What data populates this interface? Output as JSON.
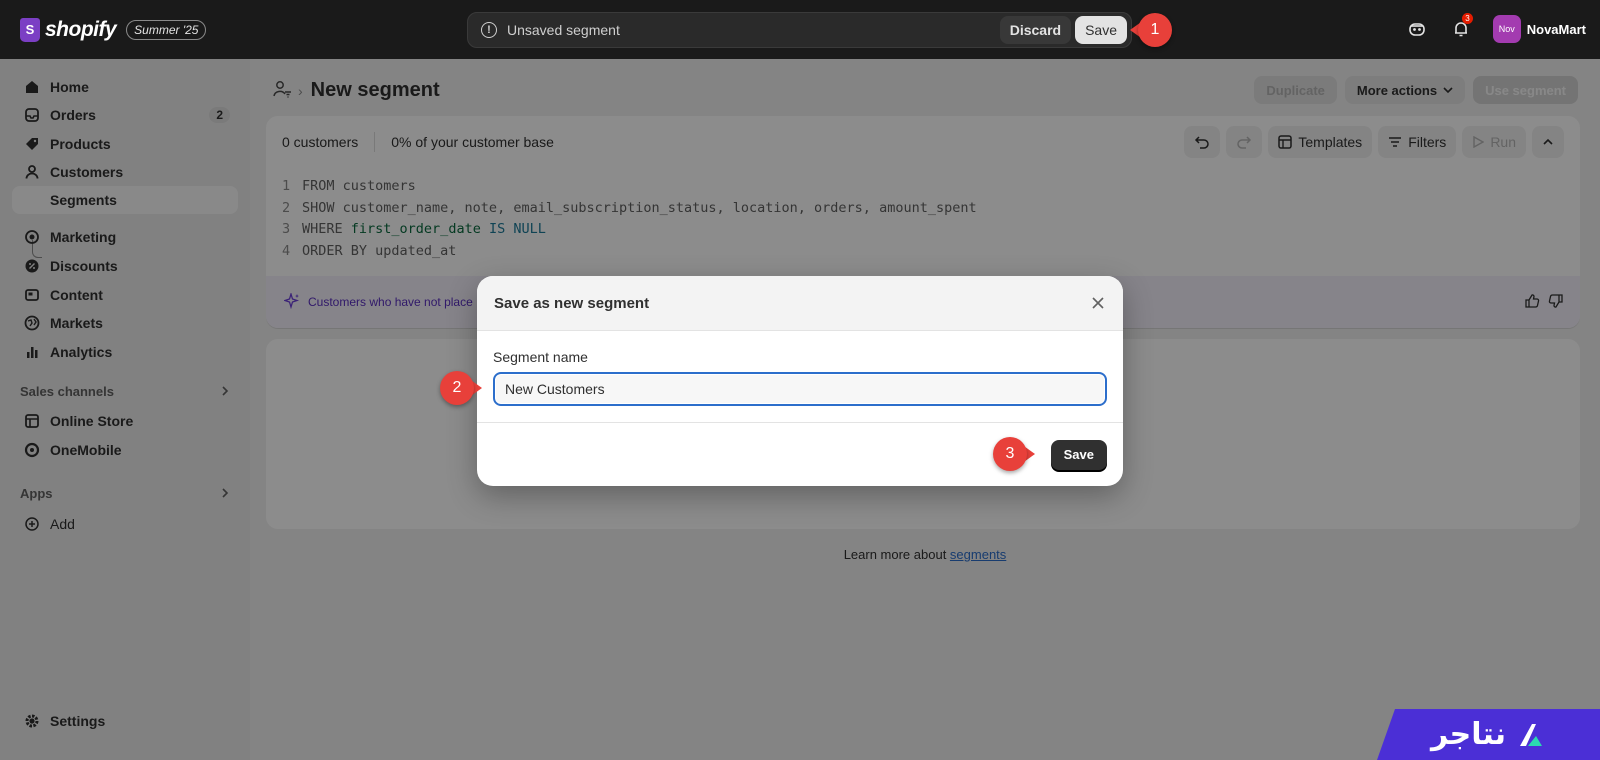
{
  "topbar": {
    "brand_letter": "S",
    "brand_name": "shopify",
    "edition": "Summer '25",
    "savebar_label": "Unsaved segment",
    "discard_label": "Discard",
    "save_label": "Save",
    "notification_count": "3",
    "avatar_initials": "Nov",
    "store_name": "NovaMart"
  },
  "sidebar": {
    "items": [
      {
        "label": "Home",
        "icon": "home-icon"
      },
      {
        "label": "Orders",
        "icon": "orders-icon",
        "badge": "2"
      },
      {
        "label": "Products",
        "icon": "tag-icon"
      },
      {
        "label": "Customers",
        "icon": "person-icon"
      },
      {
        "label": "Segments",
        "icon": "sub-item"
      },
      {
        "label": "Marketing",
        "icon": "target-icon"
      },
      {
        "label": "Discounts",
        "icon": "discount-icon"
      },
      {
        "label": "Content",
        "icon": "content-icon"
      },
      {
        "label": "Markets",
        "icon": "globe-icon"
      },
      {
        "label": "Analytics",
        "icon": "bar-chart-icon"
      }
    ],
    "sales_channels_label": "Sales channels",
    "channels": [
      {
        "label": "Online Store",
        "icon": "store-icon"
      },
      {
        "label": "OneMobile",
        "icon": "onemobile-icon"
      }
    ],
    "apps_label": "Apps",
    "add_label": "Add",
    "settings_label": "Settings"
  },
  "page": {
    "title": "New segment",
    "actions": {
      "duplicate": "Duplicate",
      "more_actions": "More actions",
      "use_segment": "Use segment"
    }
  },
  "editor": {
    "customers_count": "0 customers",
    "base_percent": "0% of your customer base",
    "templates_label": "Templates",
    "filters_label": "Filters",
    "run_label": "Run",
    "code_lines": [
      {
        "n": "1",
        "parts": [
          {
            "t": "FROM customers",
            "c": ""
          }
        ]
      },
      {
        "n": "2",
        "parts": [
          {
            "t": "SHOW customer_name, note, email_subscription_status, location, orders, amount_spent",
            "c": ""
          }
        ]
      },
      {
        "n": "3",
        "parts": [
          {
            "t": "WHERE ",
            "c": ""
          },
          {
            "t": "first_order_date",
            "c": "fld"
          },
          {
            "t": " IS NULL",
            "c": "kw"
          }
        ]
      },
      {
        "n": "4",
        "parts": [
          {
            "t": "ORDER BY updated_at",
            "c": ""
          }
        ]
      }
    ],
    "ai_summary": "Customers who have not place"
  },
  "footer": {
    "learn_prefix": "Learn more about ",
    "learn_link": "segments"
  },
  "modal": {
    "title": "Save as new segment",
    "field_label": "Segment name",
    "field_value": "New Customers",
    "save_label": "Save"
  },
  "markers": [
    "1",
    "2",
    "3"
  ],
  "watermark": {
    "text": "نتاجر",
    "color": "#4b2fd6"
  },
  "colors": {
    "marker": "#e8403a",
    "focus": "#2c6ecb",
    "brand": "#7b3fc4"
  }
}
